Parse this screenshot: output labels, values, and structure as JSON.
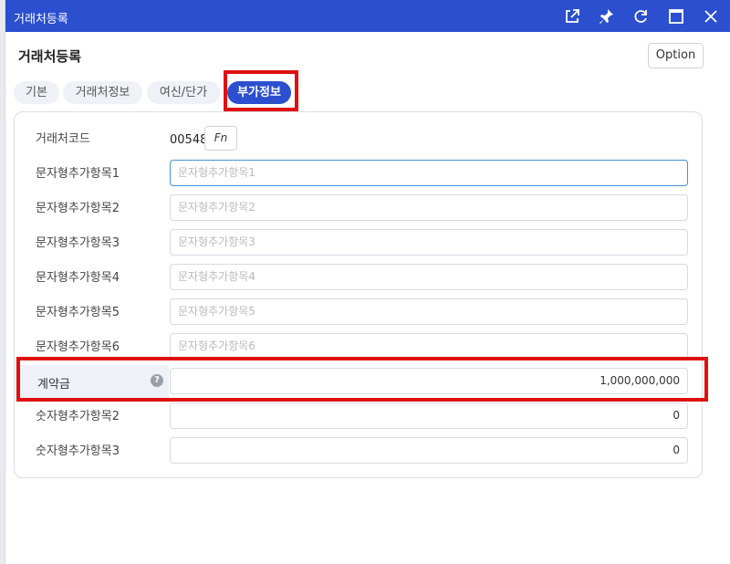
{
  "window": {
    "title": "거래처등록"
  },
  "header": {
    "title": "거래처등록",
    "option_label": "Option"
  },
  "tabs": [
    {
      "label": "기본"
    },
    {
      "label": "거래처정보"
    },
    {
      "label": "여신/단가"
    },
    {
      "label": "부가정보",
      "active": true
    }
  ],
  "form": {
    "code": {
      "label": "거래처코드",
      "value": "00548",
      "fn_label": "Fn"
    },
    "text_fields": [
      {
        "label": "문자형추가항목1",
        "placeholder": "문자형추가항목1"
      },
      {
        "label": "문자형추가항목2",
        "placeholder": "문자형추가항목2"
      },
      {
        "label": "문자형추가항목3",
        "placeholder": "문자형추가항목3"
      },
      {
        "label": "문자형추가항목4",
        "placeholder": "문자형추가항목4"
      },
      {
        "label": "문자형추가항목5",
        "placeholder": "문자형추가항목5"
      },
      {
        "label": "문자형추가항목6",
        "placeholder": "문자형추가항목6"
      }
    ],
    "amount": {
      "label": "계약금",
      "value": "1,000,000,000",
      "help": "?"
    },
    "num_fields": [
      {
        "label": "숫자형추가항목2",
        "value": "0"
      },
      {
        "label": "숫자형추가항목3",
        "value": "0"
      }
    ]
  },
  "colors": {
    "titlebar": "#2b4fcf",
    "highlight": "#e01010"
  },
  "icons": [
    "external-link-icon",
    "pin-icon",
    "refresh-icon",
    "maximize-icon",
    "close-icon",
    "help-icon"
  ]
}
